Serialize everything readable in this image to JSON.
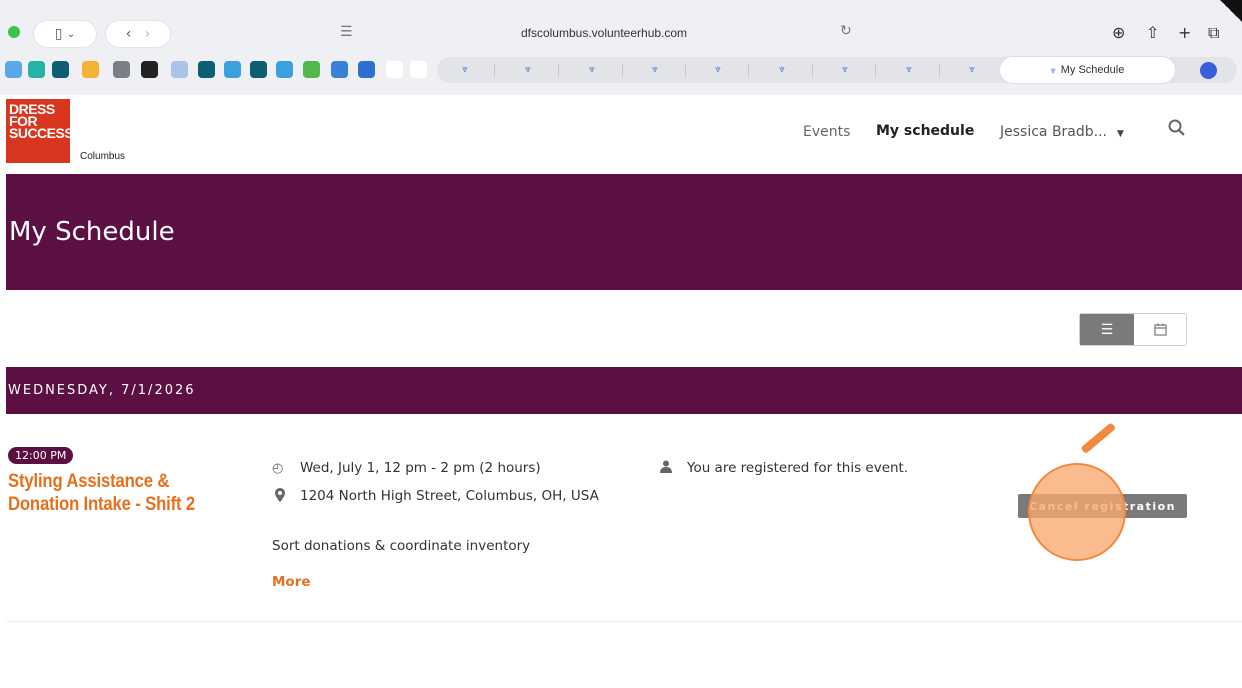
{
  "browser": {
    "url": "dfscolumbus.volunteerhub.com",
    "active_tab": "My Schedule",
    "icons": [
      "sidebar-icon",
      "chevron-down-icon",
      "back-icon",
      "forward-icon",
      "reader-icon",
      "reload-icon",
      "download-icon",
      "share-icon",
      "new-tab-icon",
      "tabs-overview-icon"
    ]
  },
  "header": {
    "logo_line1": "DRESS",
    "logo_line2": "FOR",
    "logo_line3": "SUCCESS",
    "logo_sub": "Columbus",
    "nav": {
      "events": "Events",
      "my_schedule": "My schedule",
      "user": "Jessica Bradb..."
    }
  },
  "banner": {
    "title": "My Schedule"
  },
  "date_heading": "WEDNESDAY, 7/1/2026",
  "event": {
    "time": "12:00 PM",
    "title": "Styling Assistance & Donation Intake - Shift 2",
    "when": "Wed, July 1, 12 pm - 2 pm (2 hours)",
    "where": "1204 North High Street, Columbus, OH, USA",
    "status": "You are registered for this event.",
    "description": "Sort donations & coordinate inventory",
    "more_link": "More",
    "cancel_button": "Cancel registration"
  },
  "colors": {
    "brand_purple": "#5c0f42",
    "accent_orange": "#e5701e",
    "logo_red": "#d9361f",
    "button_gray": "#7a7a7a"
  }
}
